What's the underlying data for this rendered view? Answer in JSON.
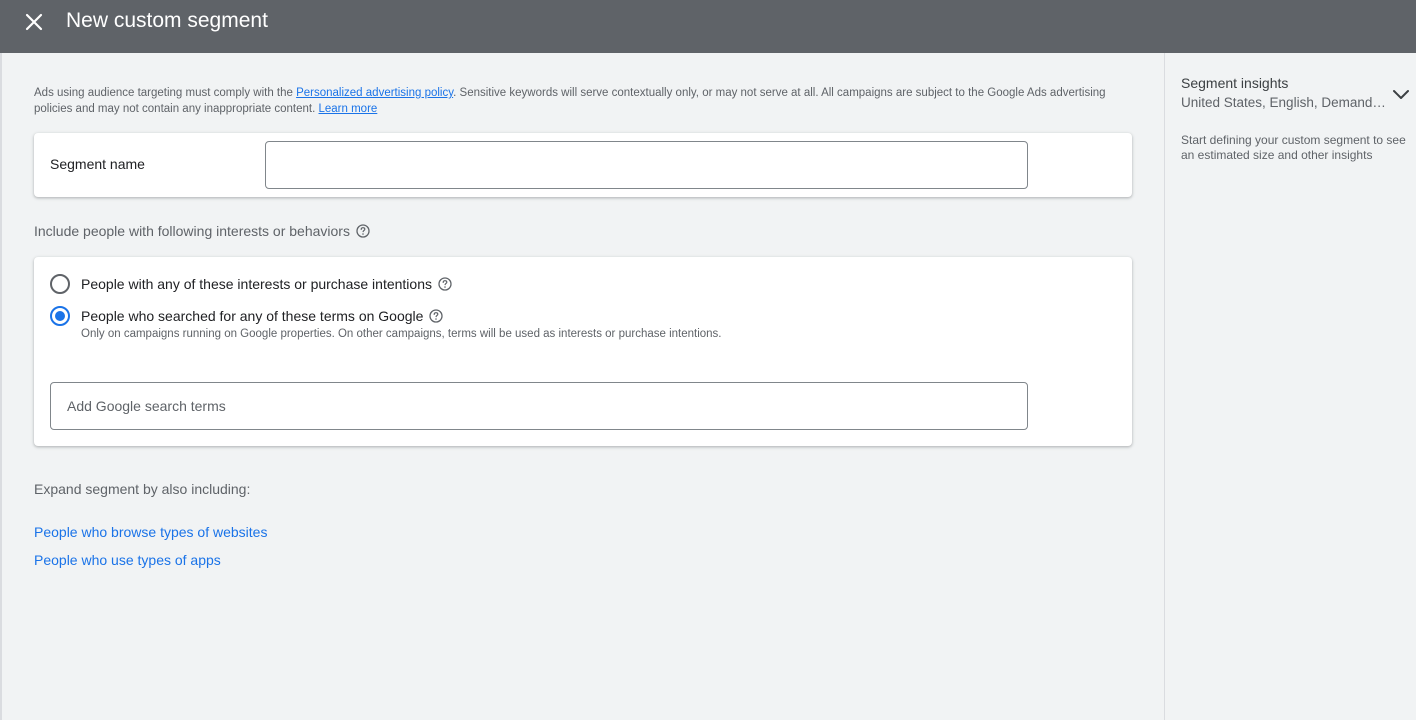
{
  "header": {
    "title": "New custom segment",
    "close_icon": "close-icon"
  },
  "policy": {
    "text_before": "Ads using audience targeting must comply with the ",
    "link_policy": "Personalized advertising policy",
    "text_middle": ". Sensitive keywords will serve contextually only, or may not serve at all. All campaigns are subject to the Google Ads advertising policies and may not contain any inappropriate content. ",
    "link_learn": "Learn more"
  },
  "segment_name": {
    "label": "Segment name",
    "value": ""
  },
  "include": {
    "label": "Include people with following interests or behaviors",
    "help_icon": "help-icon",
    "options": [
      {
        "label": "People with any of these interests or purchase intentions",
        "sublabel": "",
        "checked": false
      },
      {
        "label": "People who searched for any of these terms on Google",
        "sublabel": "Only on campaigns running on Google properties. On other campaigns, terms will be used as interests or purchase intentions.",
        "checked": true
      }
    ],
    "search_placeholder": "Add Google search terms"
  },
  "expand": {
    "label": "Expand segment by also including:",
    "links": [
      "People who browse types of websites",
      "People who use types of apps"
    ]
  },
  "insights": {
    "title": "Segment insights",
    "subtitle": "United States, English, Demand Gen",
    "description": "Start defining your custom segment to see an estimated size and other insights",
    "chevron_icon": "chevron-down-icon"
  },
  "colors": {
    "header_bg": "#5f6368",
    "accent": "#1a73e8",
    "page_bg": "#f1f3f4"
  }
}
